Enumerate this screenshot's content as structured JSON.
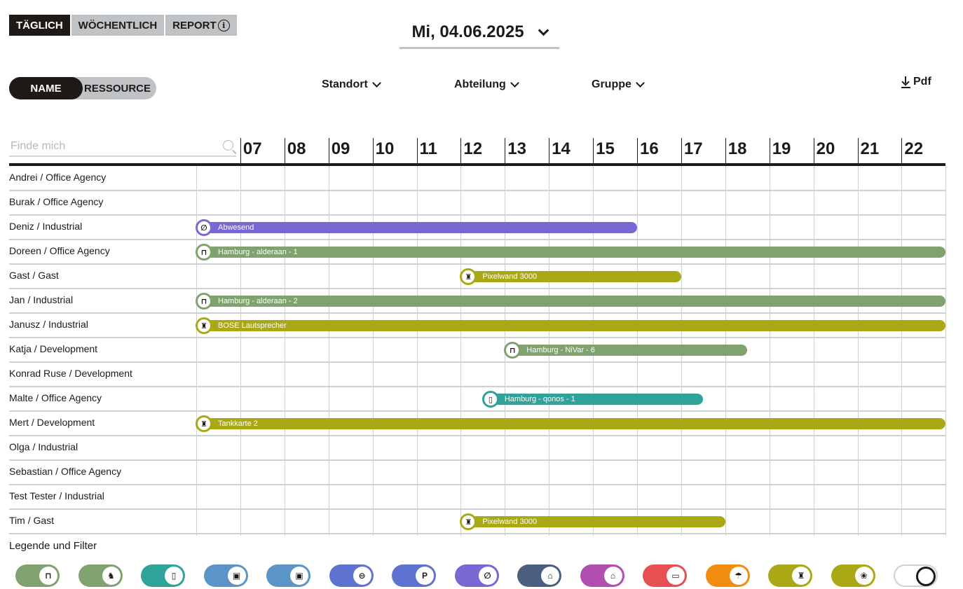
{
  "view_tabs": [
    {
      "label": "TÄGLICH",
      "active": true
    },
    {
      "label": "WÖCHENTLICH",
      "active": false
    },
    {
      "label": "REPORT",
      "active": false
    }
  ],
  "date": "Mi, 04.06.2025",
  "mode_toggle": {
    "name": "NAME",
    "resource": "RESSOURCE"
  },
  "filters": {
    "standort": "Standort",
    "abteilung": "Abteilung",
    "gruppe": "Gruppe"
  },
  "pdf_label": "Pdf",
  "search": {
    "placeholder": "Finde mich",
    "value": ""
  },
  "hours": [
    "07",
    "08",
    "09",
    "10",
    "11",
    "12",
    "13",
    "14",
    "15",
    "16",
    "17",
    "18",
    "19",
    "20",
    "21",
    "22"
  ],
  "rows": [
    {
      "name": "Andrei / Office Agency"
    },
    {
      "name": "Burak / Office Agency"
    },
    {
      "name": "Deniz / Industrial"
    },
    {
      "name": "Doreen / Office Agency"
    },
    {
      "name": "Gast / Gast"
    },
    {
      "name": "Jan / Industrial"
    },
    {
      "name": "Janusz / Industrial"
    },
    {
      "name": "Katja / Development"
    },
    {
      "name": "Konrad Ruse / Development"
    },
    {
      "name": "Malte / Office Agency"
    },
    {
      "name": "Mert / Development"
    },
    {
      "name": "Olga / Industrial"
    },
    {
      "name": "Sebastian / Office Agency"
    },
    {
      "name": "Test Tester / Industrial"
    },
    {
      "name": "Tim / Gast"
    }
  ],
  "bookings": [
    {
      "row": 2,
      "start": 6,
      "end": 16,
      "label": "Abwesend",
      "color": "#7b67d4",
      "icon": "absent-icon",
      "glyph": "∅"
    },
    {
      "row": 3,
      "start": 6,
      "end": 23,
      "label": "Hamburg - alderaan - 1",
      "color": "#7fa26f",
      "icon": "desk-icon",
      "glyph": "⊓"
    },
    {
      "row": 4,
      "start": 12,
      "end": 17,
      "label": "Pixelwand 3000",
      "color": "#a9a916",
      "icon": "equipment-icon",
      "glyph": "♜"
    },
    {
      "row": 5,
      "start": 6,
      "end": 23,
      "label": "Hamburg - alderaan - 2",
      "color": "#7fa26f",
      "icon": "desk-icon",
      "glyph": "⊓"
    },
    {
      "row": 6,
      "start": 6,
      "end": 23,
      "label": "BOSE Lautsprecher",
      "color": "#a9a916",
      "icon": "equipment-icon",
      "glyph": "♜"
    },
    {
      "row": 7,
      "start": 13,
      "end": 18.5,
      "label": "Hamburg - NiVar - 6",
      "color": "#7fa26f",
      "icon": "desk-icon",
      "glyph": "⊓"
    },
    {
      "row": 9,
      "start": 12.5,
      "end": 17.5,
      "label": "Hamburg - qonos - 1",
      "color": "#2fa39a",
      "icon": "room-icon",
      "glyph": "▯"
    },
    {
      "row": 10,
      "start": 6,
      "end": 23,
      "label": "Tankkarte 2",
      "color": "#a9a916",
      "icon": "equipment-icon",
      "glyph": "♜"
    },
    {
      "row": 14,
      "start": 12,
      "end": 18,
      "label": "Pixelwand 3000",
      "color": "#a9a916",
      "icon": "equipment-icon",
      "glyph": "♜"
    }
  ],
  "legend_title": "Legende und Filter",
  "legend": [
    {
      "icon": "desk-icon",
      "glyph": "⊓",
      "color": "#7fa26f"
    },
    {
      "icon": "person-desk-icon",
      "glyph": "♞",
      "color": "#7fa26f"
    },
    {
      "icon": "room-icon",
      "glyph": "▯",
      "color": "#2fa39a"
    },
    {
      "icon": "briefcase-icon",
      "glyph": "▣",
      "color": "#5b95c8"
    },
    {
      "icon": "briefcase-icon",
      "glyph": "▣",
      "color": "#5b95c8"
    },
    {
      "icon": "car-icon",
      "glyph": "⊖",
      "color": "#5e73cf"
    },
    {
      "icon": "parking-icon",
      "glyph": "P",
      "color": "#5e73cf"
    },
    {
      "icon": "absent-icon",
      "glyph": "∅",
      "color": "#7b67d4"
    },
    {
      "icon": "education-icon",
      "glyph": "⌂",
      "color": "#4d5f80"
    },
    {
      "icon": "home-office-icon",
      "glyph": "⌂",
      "color": "#b14fb0"
    },
    {
      "icon": "sick-icon",
      "glyph": "▭",
      "color": "#e84f52"
    },
    {
      "icon": "vacation-icon",
      "glyph": "☂",
      "color": "#f28c0f"
    },
    {
      "icon": "equipment-icon",
      "glyph": "♜",
      "color": "#a9a916"
    },
    {
      "icon": "pet-icon",
      "glyph": "❀",
      "color": "#a9a916"
    },
    {
      "icon": "all-off-toggle",
      "glyph": "",
      "color": "#ffffff",
      "off": true
    }
  ]
}
